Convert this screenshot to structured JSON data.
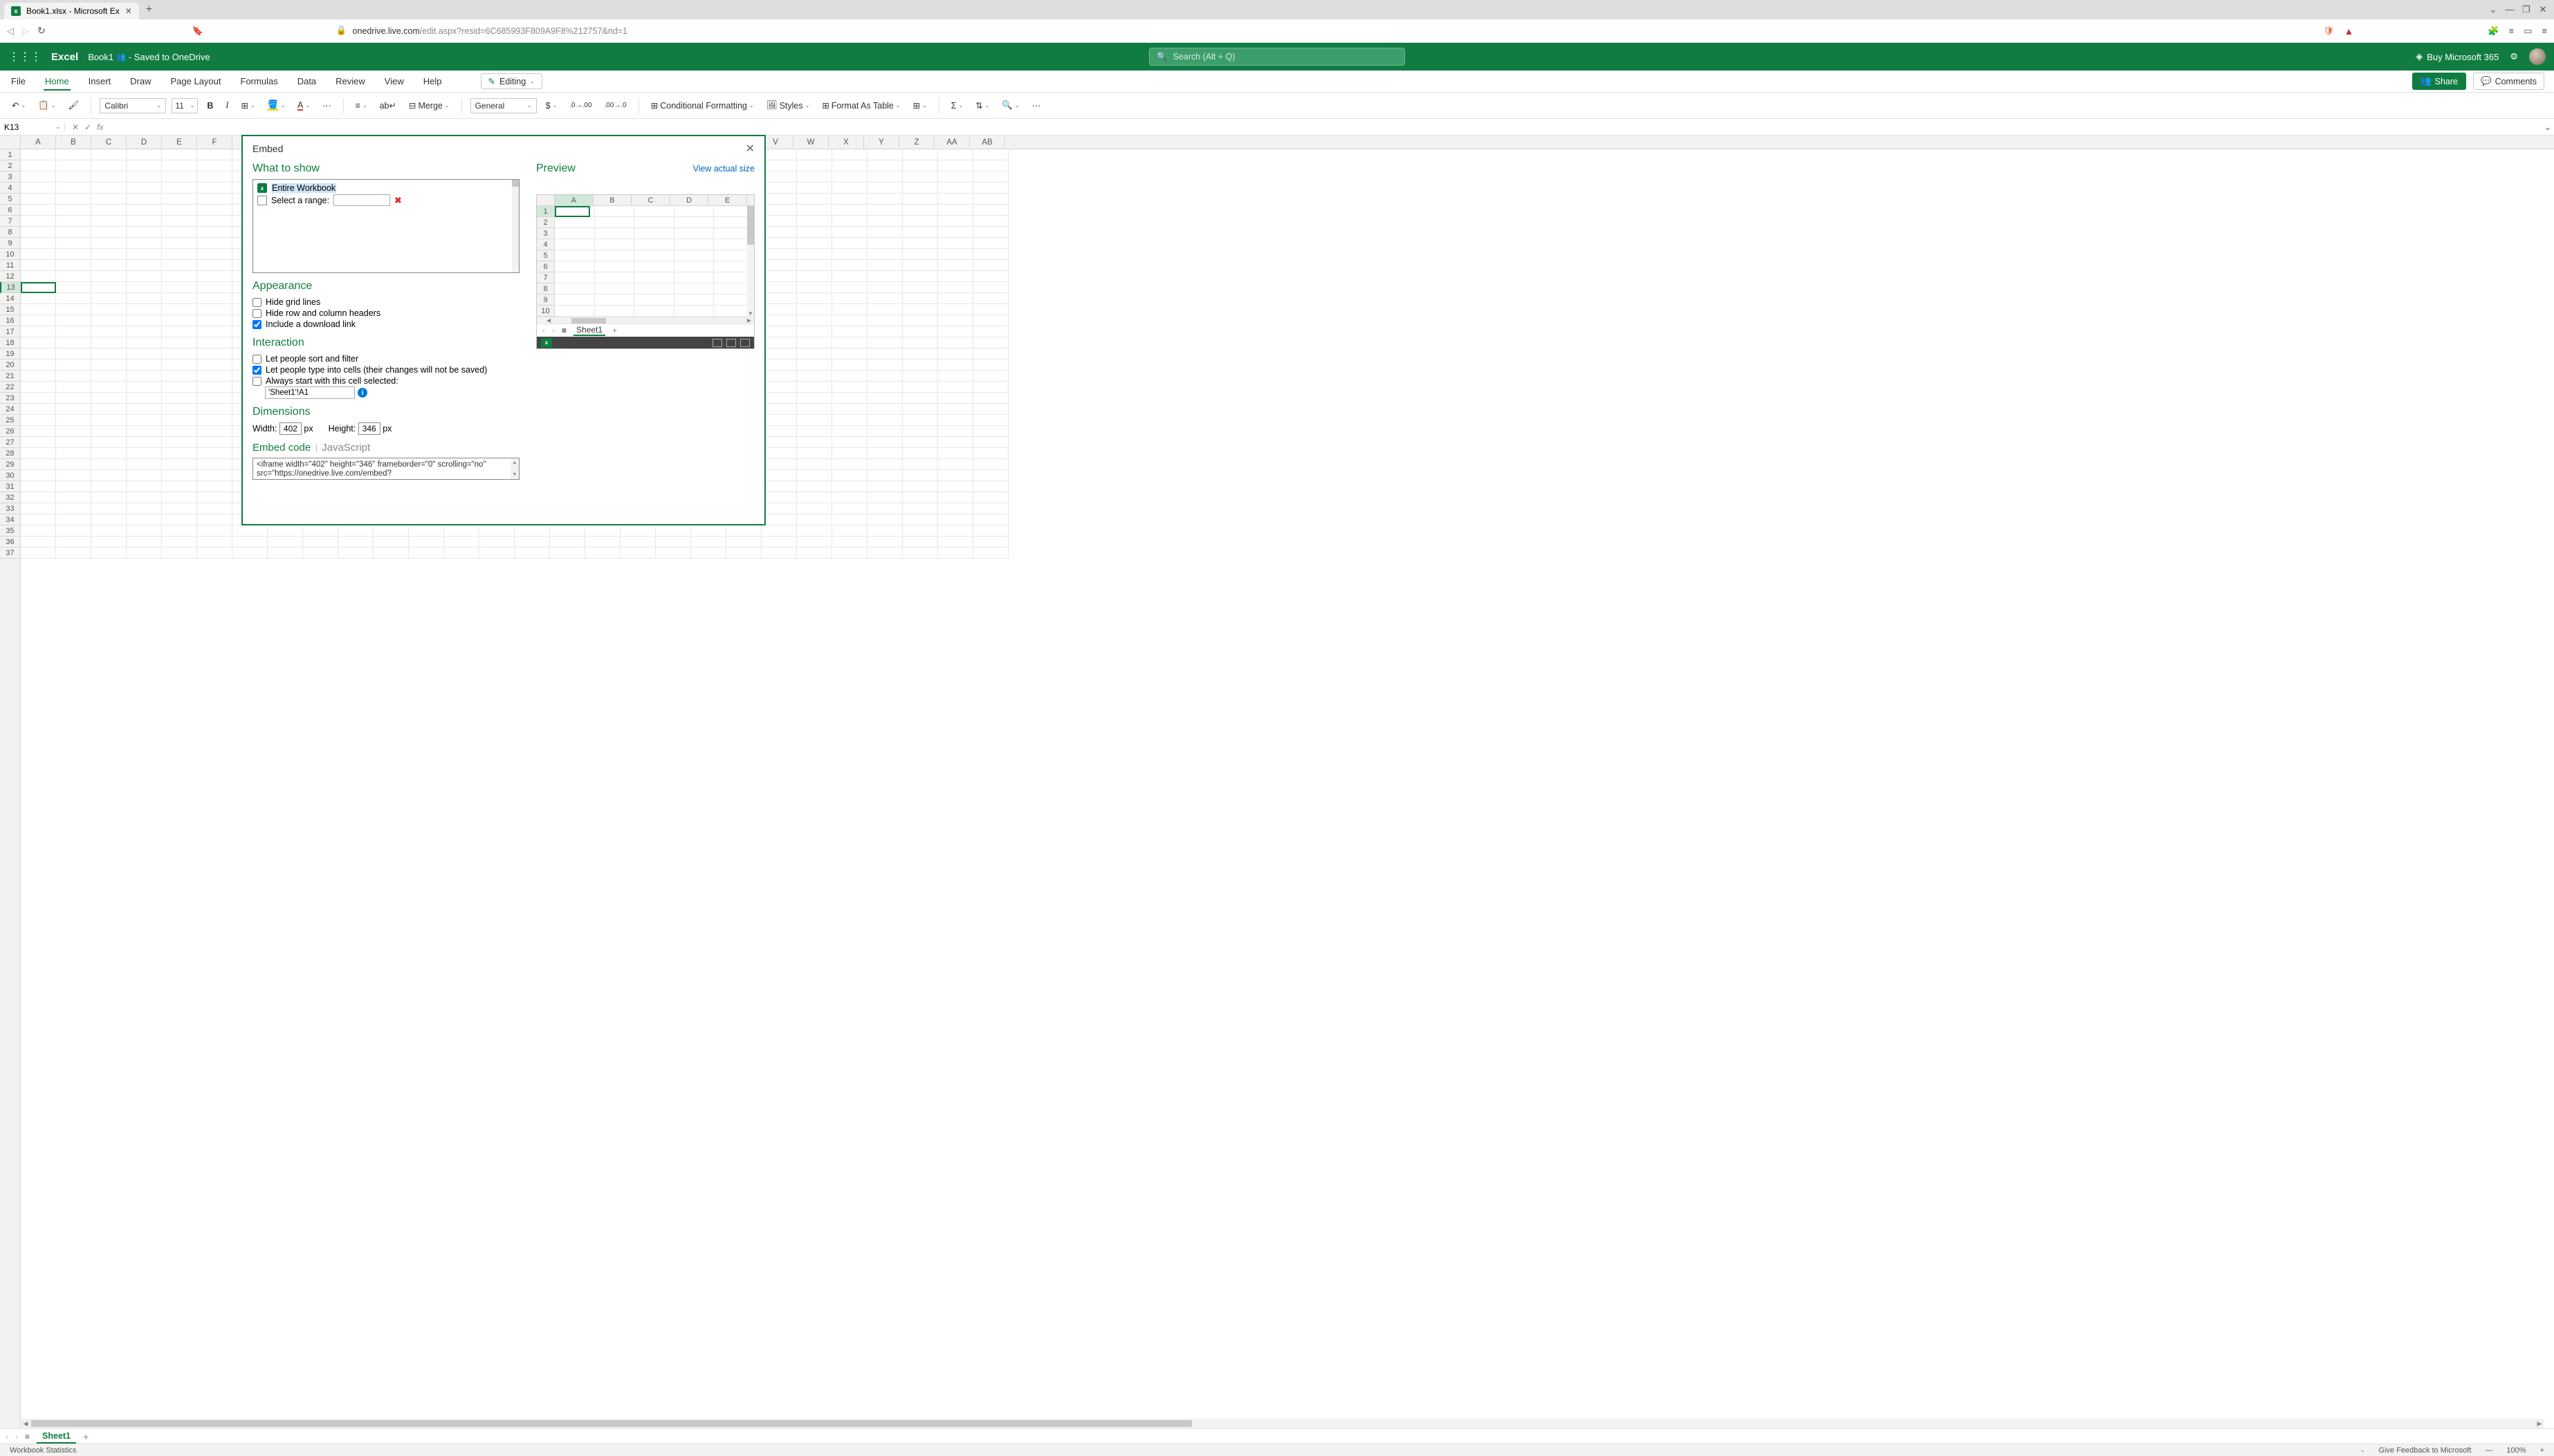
{
  "browser": {
    "tab_title": "Book1.xlsx - Microsoft Ex",
    "url_host": "onedrive.live.com",
    "url_path": "/edit.aspx?resid=6C685993F809A9F8%212757&nd=1"
  },
  "header": {
    "brand": "Excel",
    "doc_name": "Book1",
    "saved_status": "- Saved to OneDrive",
    "search_placeholder": "Search (Alt + Q)",
    "buy_label": "Buy Microsoft 365"
  },
  "ribbon_tabs": {
    "file": "File",
    "home": "Home",
    "insert": "Insert",
    "draw": "Draw",
    "page_layout": "Page Layout",
    "formulas": "Formulas",
    "data": "Data",
    "review": "Review",
    "view": "View",
    "help": "Help",
    "editing_mode": "Editing",
    "share": "Share",
    "comments": "Comments"
  },
  "toolbar": {
    "font_name": "Calibri",
    "font_size": "11",
    "merge": "Merge",
    "number_format": "General",
    "cond_format": "Conditional Formatting",
    "styles": "Styles",
    "format_table": "Format As Table"
  },
  "formula_bar": {
    "name_box": "K13"
  },
  "columns": [
    "A",
    "B",
    "C",
    "D",
    "E",
    "F",
    "",
    "",
    "",
    "",
    "",
    "",
    "",
    "",
    "V",
    "W",
    "X",
    "Y",
    "Z",
    "AA",
    "AB"
  ],
  "preview_columns": [
    "A",
    "B",
    "C",
    "D",
    "E"
  ],
  "sheet": {
    "name": "Sheet1"
  },
  "status_bar": {
    "left": "Workbook Statistics",
    "feedback": "Give Feedback to Microsoft",
    "zoom": "100%"
  },
  "dialog": {
    "title": "Embed",
    "what_to_show": {
      "heading": "What to show",
      "entire_workbook": "Entire Workbook",
      "select_range_label": "Select a range:"
    },
    "appearance": {
      "heading": "Appearance",
      "hide_grid": "Hide grid lines",
      "hide_headers": "Hide row and column headers",
      "download_link": "Include a download link"
    },
    "interaction": {
      "heading": "Interaction",
      "sort_filter": "Let people sort and filter",
      "type_cells": "Let people type into cells (their changes will not be saved)",
      "start_cell": "Always start with this cell selected:",
      "start_cell_value": "'Sheet1'!A1"
    },
    "dimensions": {
      "heading": "Dimensions",
      "width_label": "Width:",
      "width_value": "402",
      "height_label": "Height:",
      "height_value": "346",
      "px": "px"
    },
    "embed": {
      "tab_code": "Embed code",
      "tab_js": "JavaScript",
      "code": "<iframe width=\"402\" height=\"346\" frameborder=\"0\" scrolling=\"no\" src=\"https://onedrive.live.com/embed?"
    },
    "preview": {
      "heading": "Preview",
      "view_actual": "View actual size",
      "sheet": "Sheet1"
    }
  }
}
